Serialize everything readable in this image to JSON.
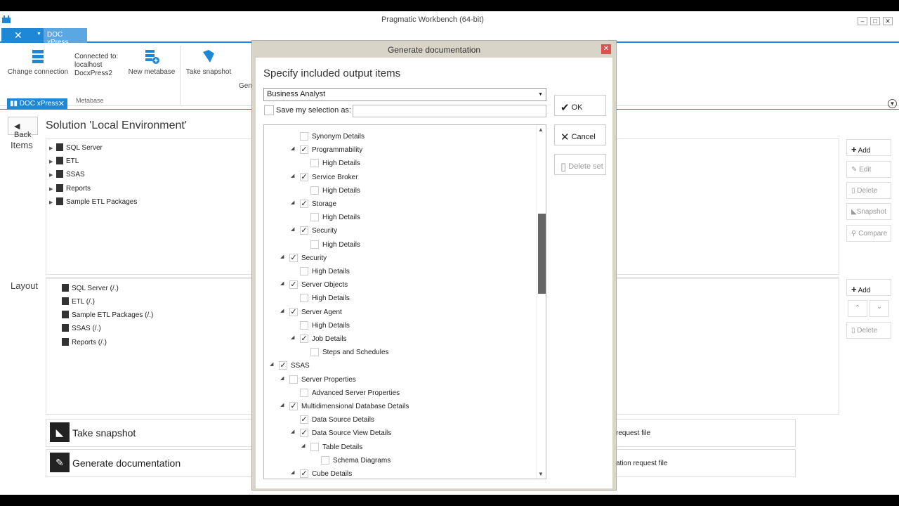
{
  "window": {
    "title": "Pragmatic Workbench (64-bit)",
    "minimize": "–",
    "maximize": "□",
    "close": "✕"
  },
  "ribbon": {
    "app_tab": "DOC xPress",
    "change_connection": "Change connection",
    "connected_to_label": "Connected to:",
    "connected_host": "localhost",
    "connected_db": "DocxPress2",
    "new_metabase": "New metabase",
    "take_snapshot": "Take snapshot",
    "gen_partial": "Gen",
    "group_metabase": "Metabase"
  },
  "doc_tab": {
    "label": "DOC xPress",
    "close": "✕"
  },
  "solution": {
    "back_label": "Back",
    "title": "Solution 'Local Environment'",
    "items_label": "Items",
    "layout_label": "Layout",
    "items": [
      "SQL Server",
      "ETL",
      "SSAS",
      "Reports",
      "Sample ETL Packages"
    ],
    "layout": [
      "SQL Server (/.)",
      "ETL (/.)",
      "Sample ETL Packages (/.)",
      "SSAS (/.)",
      "Reports (/.)"
    ],
    "items_buttons": [
      "Add",
      "Edit",
      "Delete",
      "Snapshot",
      "Compare"
    ],
    "layout_buttons": [
      "Add",
      "Delete"
    ],
    "take_snapshot_btn": "Take snapshot",
    "generate_doc_btn": "Generate documentation",
    "snapshot_request": "request file",
    "doc_request": "ation request file"
  },
  "dialog": {
    "title": "Generate documentation",
    "heading": "Specify included output items",
    "preset": "Business Analyst",
    "save_label": "Save my selection as:",
    "ok": "OK",
    "cancel": "Cancel",
    "delete_set": "Delete set",
    "rows": [
      {
        "label": "Synonym Details",
        "level": 3,
        "exp": false,
        "checked": false
      },
      {
        "label": "Programmability",
        "level": 3,
        "exp": true,
        "checked": true
      },
      {
        "label": "High Details",
        "level": 4,
        "exp": false,
        "checked": false
      },
      {
        "label": "Service Broker",
        "level": 3,
        "exp": true,
        "checked": true
      },
      {
        "label": "High Details",
        "level": 4,
        "exp": false,
        "checked": false
      },
      {
        "label": "Storage",
        "level": 3,
        "exp": true,
        "checked": true
      },
      {
        "label": "High Details",
        "level": 4,
        "exp": false,
        "checked": false
      },
      {
        "label": "Security",
        "level": 3,
        "exp": true,
        "checked": true
      },
      {
        "label": "High Details",
        "level": 4,
        "exp": false,
        "checked": false
      },
      {
        "label": "Security",
        "level": 2,
        "exp": true,
        "checked": true
      },
      {
        "label": "High Details",
        "level": 3,
        "exp": false,
        "checked": false
      },
      {
        "label": "Server Objects",
        "level": 2,
        "exp": true,
        "checked": true
      },
      {
        "label": "High Details",
        "level": 3,
        "exp": false,
        "checked": false
      },
      {
        "label": "Server Agent",
        "level": 2,
        "exp": true,
        "checked": true
      },
      {
        "label": "High Details",
        "level": 3,
        "exp": false,
        "checked": false
      },
      {
        "label": "Job Details",
        "level": 3,
        "exp": true,
        "checked": true
      },
      {
        "label": "Steps and Schedules",
        "level": 4,
        "exp": false,
        "checked": false
      },
      {
        "label": "SSAS",
        "level": 1,
        "exp": true,
        "checked": true
      },
      {
        "label": "Server Properties",
        "level": 2,
        "exp": true,
        "checked": false
      },
      {
        "label": "Advanced Server Properties",
        "level": 3,
        "exp": false,
        "checked": false
      },
      {
        "label": "Multidimensional Database Details",
        "level": 2,
        "exp": true,
        "checked": true
      },
      {
        "label": "Data Source Details",
        "level": 3,
        "exp": false,
        "checked": true
      },
      {
        "label": "Data Source View Details",
        "level": 3,
        "exp": true,
        "checked": true
      },
      {
        "label": "Table Details",
        "level": 4,
        "exp": true,
        "checked": false
      },
      {
        "label": "Schema Diagrams",
        "level": 5,
        "exp": false,
        "checked": false
      },
      {
        "label": "Cube Details",
        "level": 3,
        "exp": true,
        "checked": true
      }
    ]
  }
}
